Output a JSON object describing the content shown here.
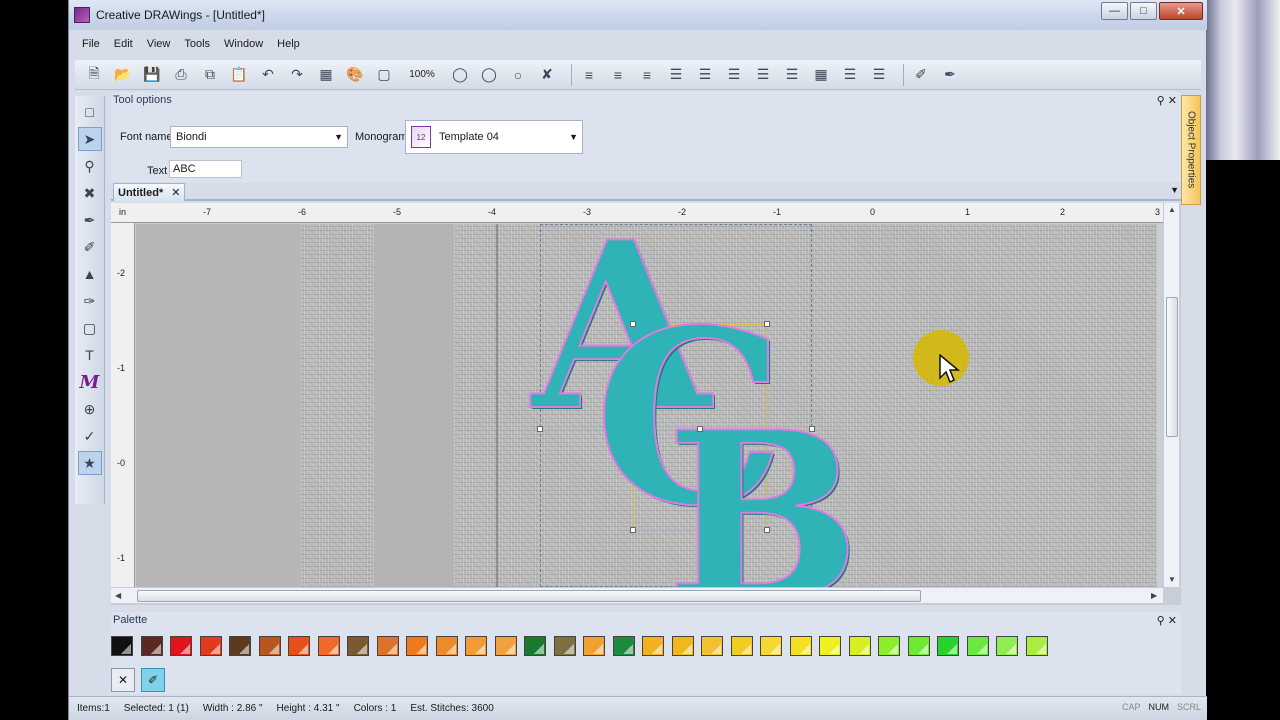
{
  "window": {
    "title": "Creative DRAWings - [Untitled*]"
  },
  "menu": [
    "File",
    "Edit",
    "View",
    "Tools",
    "Window",
    "Help"
  ],
  "toolbar": {
    "zoom": "100%"
  },
  "tool_options": {
    "header": "Tool options",
    "font_label": "Font name",
    "font_value": "Biondi",
    "monogram_label": "Monogram",
    "monogram_value": "Template 04",
    "text_label": "Text",
    "text_value": "ABC"
  },
  "side_panel": {
    "label": "Object Properties"
  },
  "document": {
    "tab": "Untitled*"
  },
  "ruler": {
    "unit": "in",
    "top_ticks": [
      "-7",
      "-6",
      "-5",
      "-4",
      "-3",
      "-2",
      "-1",
      "0",
      "1",
      "2",
      "3"
    ],
    "left_ticks": [
      "-2",
      "-1",
      "-0",
      "-1"
    ]
  },
  "design": {
    "letters": [
      "A",
      "C",
      "B"
    ],
    "thread_color": "#2fb3b7",
    "outline_color": "#e07be0"
  },
  "palette": {
    "header": "Palette",
    "colors": [
      "#111111",
      "#5a2a22",
      "#e0141a",
      "#e33a1f",
      "#5c3a1e",
      "#b8561d",
      "#e8501a",
      "#ef6a2a",
      "#7a5a30",
      "#d9742a",
      "#ef7a1c",
      "#ef8a2a",
      "#f29a3a",
      "#f2a040",
      "#187a2c",
      "#7d7040",
      "#f2a030",
      "#1c8a3c",
      "#f3b020",
      "#f2b81a",
      "#f3c030",
      "#f3cc20",
      "#f6d830",
      "#f3e020",
      "#eef020",
      "#d8ee20",
      "#8aee2a",
      "#6ee830",
      "#28d22a",
      "#6ae840",
      "#90ec50",
      "#a8ee40"
    ]
  },
  "statusbar": {
    "items": "Items:1",
    "selected": "Selected: 1 (1)",
    "width": "Width : 2.86 \"",
    "height": "Height : 4.31 \"",
    "colors": "Colors : 1",
    "stitches": "Est. Stitches: 3600",
    "cap": "CAP",
    "num": "NUM",
    "scrl": "SCRL"
  }
}
